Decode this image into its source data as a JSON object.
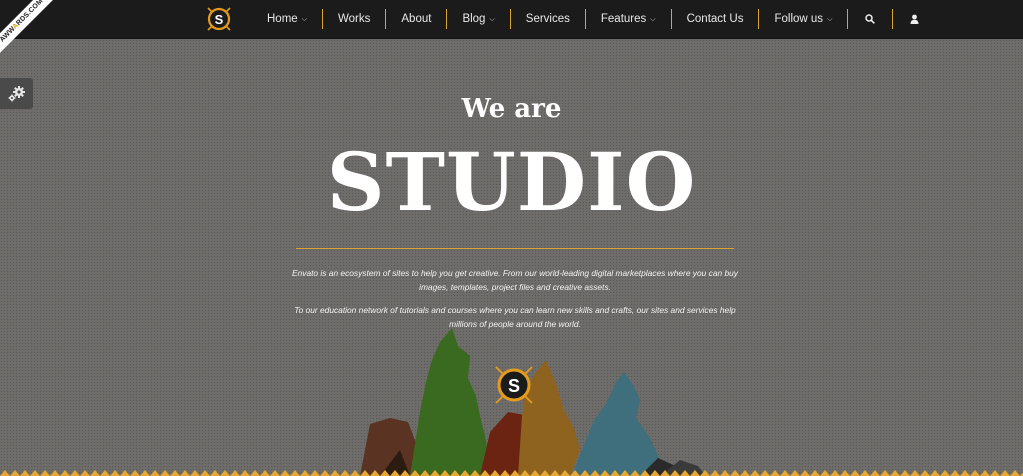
{
  "nav": {
    "logo_letter": "S",
    "items": [
      {
        "label": "Home",
        "dropdown": true
      },
      {
        "label": "Works",
        "dropdown": false
      },
      {
        "label": "About",
        "dropdown": false
      },
      {
        "label": "Blog",
        "dropdown": true
      },
      {
        "label": "Services",
        "dropdown": false
      },
      {
        "label": "Features",
        "dropdown": true
      },
      {
        "label": "Contact Us",
        "dropdown": false
      },
      {
        "label": "Follow us",
        "dropdown": true
      }
    ],
    "icons": [
      "search-icon",
      "user-icon"
    ]
  },
  "ribbon": {
    "text_a": "AWW",
    "text_b": "A",
    "text_c": "RDS",
    "text_d": ".COM"
  },
  "hero": {
    "subtitle": "We are",
    "title": "STUDIO",
    "paragraph_1": "Envato is an ecosystem of sites to help you get creative. From our world-leading digital marketplaces where you can buy images, templates, project files and creative assets.",
    "paragraph_2": "To our education network of tutorials and courses where you can learn new skills and crafts, our sites and services help millions of people around the world."
  },
  "colors": {
    "accent": "#d9a431",
    "nav_bg": "#1b1b1b",
    "page_bg": "#6f6d6a"
  }
}
